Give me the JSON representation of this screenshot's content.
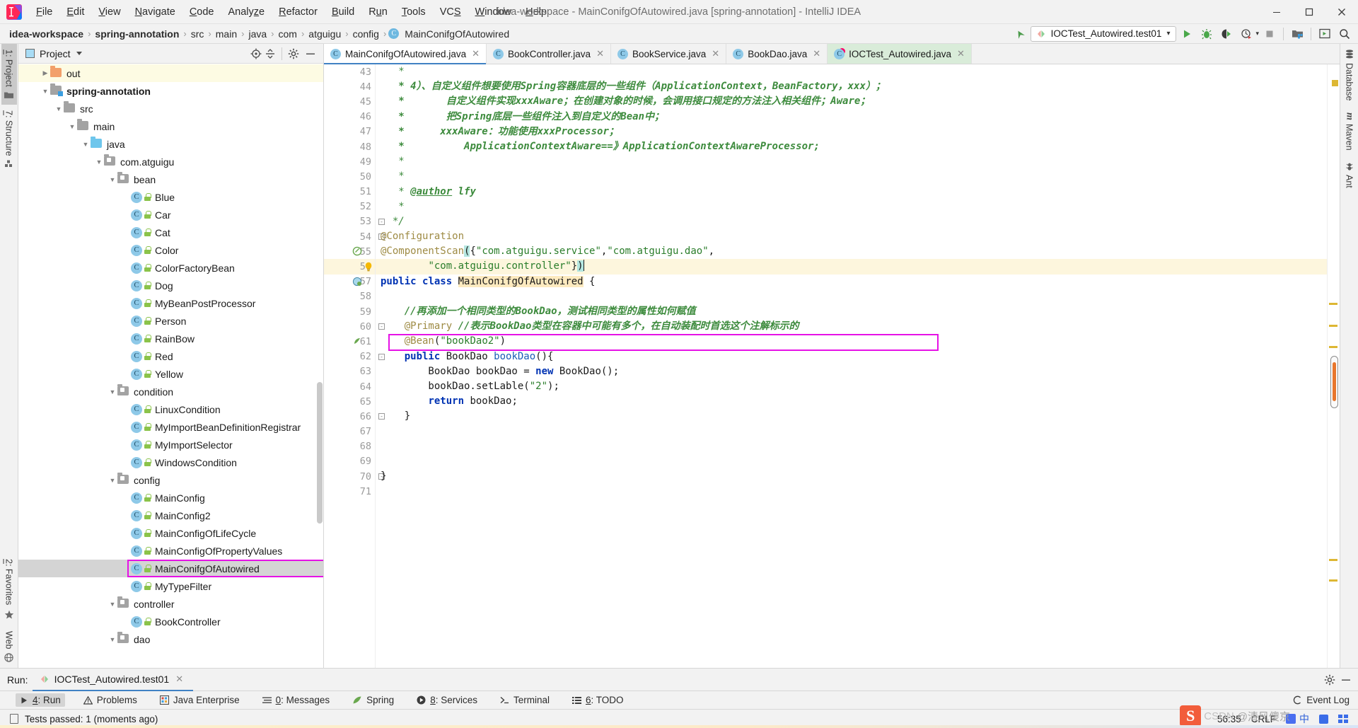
{
  "window": {
    "title": "idea-workspace - MainConifgOfAutowired.java [spring-annotation] - IntelliJ IDEA",
    "logo_text": "IJ",
    "minimize": "—",
    "maximize": "❐",
    "close": "✕"
  },
  "menu": {
    "items": [
      {
        "label": "File",
        "accel": "F"
      },
      {
        "label": "Edit",
        "accel": "E"
      },
      {
        "label": "View",
        "accel": "V"
      },
      {
        "label": "Navigate",
        "accel": "N"
      },
      {
        "label": "Code",
        "accel": "C"
      },
      {
        "label": "Analyze",
        "accel": "z"
      },
      {
        "label": "Refactor",
        "accel": "R"
      },
      {
        "label": "Build",
        "accel": "B"
      },
      {
        "label": "Run",
        "accel": "u"
      },
      {
        "label": "Tools",
        "accel": "T"
      },
      {
        "label": "VCS",
        "accel": "S"
      },
      {
        "label": "Window",
        "accel": "W"
      },
      {
        "label": "Help",
        "accel": "H"
      }
    ]
  },
  "breadcrumb": {
    "items": [
      "idea-workspace",
      "spring-annotation",
      "src",
      "main",
      "java",
      "com",
      "atguigu",
      "config"
    ],
    "separator": "›",
    "final_class": "MainConifgOfAutowired",
    "class_badge": "C"
  },
  "toolbar": {
    "run_config": "IOCTest_Autowired.test01",
    "run_config_caret": "▾",
    "buttons": [
      {
        "name": "run-button",
        "title": "Run"
      },
      {
        "name": "debug-button",
        "title": "Debug"
      },
      {
        "name": "run-coverage-button",
        "title": "Run with Coverage"
      },
      {
        "name": "profiler-button",
        "title": "Profiler"
      },
      {
        "name": "stop-button",
        "title": "Stop"
      },
      {
        "name": "project-structure-button",
        "title": "Project Structure"
      },
      {
        "name": "layout-button",
        "title": "Layout"
      },
      {
        "name": "search-everywhere-button",
        "title": "Search Everywhere"
      }
    ],
    "updates_arrow": "↖"
  },
  "left_strip": {
    "tabs": [
      {
        "label": "1: Project",
        "accel": "1",
        "icon": "folder-icon",
        "active": true
      },
      {
        "label": "7: Structure",
        "accel": "7",
        "icon": "structure-icon",
        "active": false
      },
      {
        "label": "2: Favorites",
        "accel": "2",
        "icon": "star-icon",
        "active": false
      },
      {
        "label": "Web",
        "accel": "",
        "icon": "web-icon",
        "active": false
      }
    ]
  },
  "right_strip": {
    "tabs": [
      {
        "label": "Database",
        "icon": "database-icon"
      },
      {
        "label": "Maven",
        "icon": "maven-icon"
      },
      {
        "label": "Ant",
        "icon": "ant-icon"
      }
    ]
  },
  "project_panel": {
    "title": "Project",
    "title_caret": "▾",
    "actions": [
      {
        "name": "locate-icon",
        "title": "Select Opened File"
      },
      {
        "name": "collapse-all-icon",
        "title": "Collapse All"
      },
      {
        "name": "gear-icon",
        "title": "Settings"
      },
      {
        "name": "hide-icon",
        "title": "Hide"
      }
    ],
    "tree": [
      {
        "label": "out",
        "depth": 1,
        "type": "folder-out",
        "arrow": "collapsed",
        "highlight": true
      },
      {
        "label": "spring-annotation",
        "depth": 1,
        "type": "module",
        "arrow": "expanded",
        "bold": true
      },
      {
        "label": "src",
        "depth": 2,
        "type": "folder",
        "arrow": "expanded"
      },
      {
        "label": "main",
        "depth": 3,
        "type": "folder",
        "arrow": "expanded"
      },
      {
        "label": "java",
        "depth": 4,
        "type": "folder-src",
        "arrow": "expanded"
      },
      {
        "label": "com.atguigu",
        "depth": 5,
        "type": "package",
        "arrow": "expanded"
      },
      {
        "label": "bean",
        "depth": 6,
        "type": "package",
        "arrow": "expanded"
      },
      {
        "label": "Blue",
        "depth": 7,
        "type": "class"
      },
      {
        "label": "Car",
        "depth": 7,
        "type": "class"
      },
      {
        "label": "Cat",
        "depth": 7,
        "type": "class"
      },
      {
        "label": "Color",
        "depth": 7,
        "type": "class"
      },
      {
        "label": "ColorFactoryBean",
        "depth": 7,
        "type": "class"
      },
      {
        "label": "Dog",
        "depth": 7,
        "type": "class"
      },
      {
        "label": "MyBeanPostProcessor",
        "depth": 7,
        "type": "class"
      },
      {
        "label": "Person",
        "depth": 7,
        "type": "class"
      },
      {
        "label": "RainBow",
        "depth": 7,
        "type": "class"
      },
      {
        "label": "Red",
        "depth": 7,
        "type": "class"
      },
      {
        "label": "Yellow",
        "depth": 7,
        "type": "class"
      },
      {
        "label": "condition",
        "depth": 6,
        "type": "package",
        "arrow": "expanded"
      },
      {
        "label": "LinuxCondition",
        "depth": 7,
        "type": "class"
      },
      {
        "label": "MyImportBeanDefinitionRegistrar",
        "depth": 7,
        "type": "class"
      },
      {
        "label": "MyImportSelector",
        "depth": 7,
        "type": "class"
      },
      {
        "label": "WindowsCondition",
        "depth": 7,
        "type": "class"
      },
      {
        "label": "config",
        "depth": 6,
        "type": "package",
        "arrow": "expanded"
      },
      {
        "label": "MainConfig",
        "depth": 7,
        "type": "class"
      },
      {
        "label": "MainConfig2",
        "depth": 7,
        "type": "class"
      },
      {
        "label": "MainConfigOfLifeCycle",
        "depth": 7,
        "type": "class"
      },
      {
        "label": "MainConfigOfPropertyValues",
        "depth": 7,
        "type": "class"
      },
      {
        "label": "MainConifgOfAutowired",
        "depth": 7,
        "type": "class",
        "selected": true,
        "marked": true
      },
      {
        "label": "MyTypeFilter",
        "depth": 7,
        "type": "class"
      },
      {
        "label": "controller",
        "depth": 6,
        "type": "package",
        "arrow": "expanded"
      },
      {
        "label": "BookController",
        "depth": 7,
        "type": "class"
      },
      {
        "label": "dao",
        "depth": 6,
        "type": "package",
        "arrow": "expanded"
      }
    ]
  },
  "editor": {
    "tabs": [
      {
        "label": "MainConifgOfAutowired.java",
        "active": true,
        "green": false,
        "close": "✕",
        "icon": "java-class-icon"
      },
      {
        "label": "BookController.java",
        "active": false,
        "green": false,
        "close": "✕",
        "icon": "java-class-icon"
      },
      {
        "label": "BookService.java",
        "active": false,
        "green": false,
        "close": "✕",
        "icon": "java-class-icon"
      },
      {
        "label": "BookDao.java",
        "active": false,
        "green": false,
        "close": "✕",
        "icon": "java-class-icon"
      },
      {
        "label": "IOCTest_Autowired.java",
        "active": false,
        "green": true,
        "close": "✕",
        "icon": "java-test-class-icon"
      }
    ],
    "first_line": 43,
    "lines": [
      {
        "n": 43,
        "html": "   <span class='cmt2'>*</span>"
      },
      {
        "n": 44,
        "html": "   <span class='cmt'>* 4）、自定义组件想要使用Spring容器底层的一些组件（ApplicationContext，BeanFactory，xxx）；</span>"
      },
      {
        "n": 45,
        "html": "   <span class='cmt'>*       自定义组件实现xxxAware；在创建对象的时候，会调用接口规定的方法注入相关组件；Aware；</span>"
      },
      {
        "n": 46,
        "html": "   <span class='cmt'>*       把Spring底层一些组件注入到自定义的Bean中；</span>"
      },
      {
        "n": 47,
        "html": "   <span class='cmt'>*      xxxAware：功能使用xxxProcessor；</span>"
      },
      {
        "n": 48,
        "html": "   <span class='cmt'>*          ApplicationContextAware==》ApplicationContextAwareProcessor;</span>"
      },
      {
        "n": 49,
        "html": "   <span class='cmt2'>*</span>"
      },
      {
        "n": 50,
        "html": "   <span class='cmt2'>*</span>"
      },
      {
        "n": 51,
        "html": "   <span class='cmt2'>* <span class='tag'>@author</span> <span class='cmt'>lfy</span></span>"
      },
      {
        "n": 52,
        "html": "   <span class='cmt2'>*</span>"
      },
      {
        "n": 53,
        "html": "  <span class='cmt2'>*/</span>"
      },
      {
        "n": 54,
        "html": "<span class='ann'>@Configuration</span>"
      },
      {
        "n": 55,
        "html": "<span class='ann'>@ComponentScan</span><span class='pmatch'>(</span>{<span class='str'>\"com.atguigu.service\"</span>,<span class='str'>\"com.atguigu.dao\"</span>,"
      },
      {
        "n": 56,
        "html": "        <span class='str'>\"com.atguigu.controller\"</span>}<span class='pmatch'>)</span><span class='caret-blk'></span>",
        "current": true
      },
      {
        "n": 57,
        "html": "<span class='kw'>public</span> <span class='kw'>class</span> <span class='clsname'>MainConifgOfAutowired</span> {"
      },
      {
        "n": 58,
        "html": ""
      },
      {
        "n": 59,
        "html": "    <span class='cmt'>//再添加一个相同类型的BookDao，测试相同类型的属性如何赋值</span>"
      },
      {
        "n": 60,
        "html": "    <span class='ann'>@Primary</span> <span class='cmt'>//表示BookDao类型在容器中可能有多个，在自动装配时首选这个注解标示的</span>",
        "marked": true
      },
      {
        "n": 61,
        "html": "    <span class='ann'>@Bean</span>(<span class='str'>\"bookDao2\"</span>)"
      },
      {
        "n": 62,
        "html": "    <span class='kw'>public</span> BookDao <span class='mth'>bookDao</span>(){"
      },
      {
        "n": 63,
        "html": "        BookDao bookDao = <span class='kw'>new</span> BookDao();"
      },
      {
        "n": 64,
        "html": "        bookDao.setLable(<span class='str'>\"2\"</span>);"
      },
      {
        "n": 65,
        "html": "        <span class='kw'>return</span> bookDao;"
      },
      {
        "n": 66,
        "html": "    }"
      },
      {
        "n": 67,
        "html": ""
      },
      {
        "n": 68,
        "html": ""
      },
      {
        "n": 69,
        "html": ""
      },
      {
        "n": 70,
        "html": "}"
      },
      {
        "n": 71,
        "html": ""
      }
    ]
  },
  "run_panel": {
    "label": "Run:",
    "tab_label": "IOCTest_Autowired.test01",
    "tab_close": "✕",
    "actions": [
      {
        "name": "gear-icon",
        "title": "Settings"
      },
      {
        "name": "hide-icon",
        "title": "Hide"
      }
    ]
  },
  "bottom_toolbar": {
    "items": [
      {
        "label": "4: Run",
        "accel": "4",
        "icon": "run-icon",
        "active": true
      },
      {
        "label": "Problems",
        "accel": "",
        "icon": "warning-icon",
        "active": false
      },
      {
        "label": "Java Enterprise",
        "accel": "",
        "icon": "java-ee-icon",
        "active": false
      },
      {
        "label": "0: Messages",
        "accel": "0",
        "icon": "messages-icon",
        "active": false
      },
      {
        "label": "Spring",
        "accel": "",
        "icon": "spring-leaf-icon",
        "active": false
      },
      {
        "label": "8: Services",
        "accel": "8",
        "icon": "services-icon",
        "active": false
      },
      {
        "label": "Terminal",
        "accel": "",
        "icon": "terminal-icon",
        "active": false
      },
      {
        "label": "6: TODO",
        "accel": "6",
        "icon": "todo-icon",
        "active": false
      }
    ],
    "event_log": "Event Log",
    "event_log_icon": "event-log-icon"
  },
  "status_bar": {
    "message": "Tests passed: 1 (moments ago)",
    "message_icon": "test-results-icon",
    "caret_position": "56:35",
    "line_separator": "CRLF",
    "watermark_brand": "CSDN",
    "watermark_logo": "S",
    "watermark_user": "@清风傻京",
    "ime_label": "中"
  }
}
